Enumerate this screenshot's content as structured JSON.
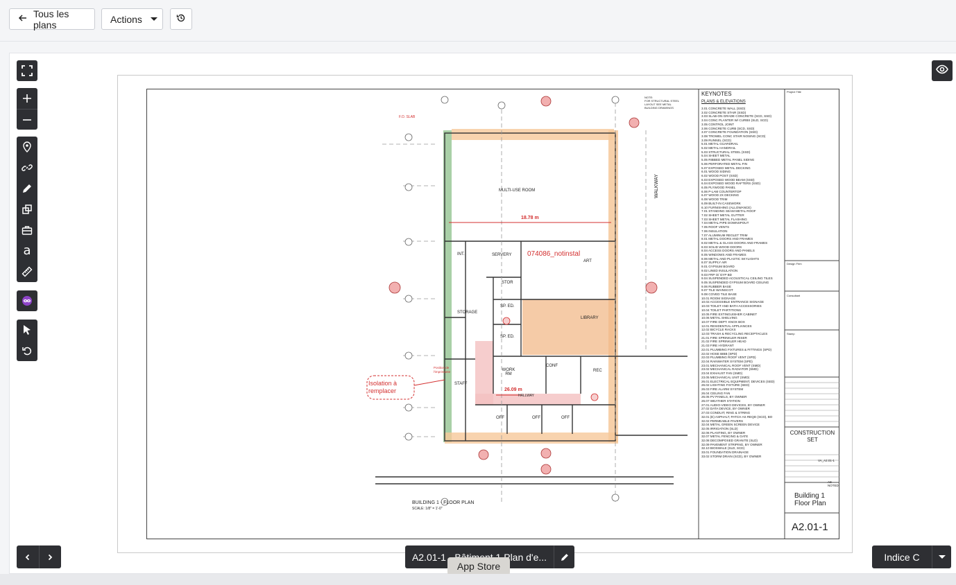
{
  "toolbar": {
    "back_label": "Tous les plans",
    "actions_label": "Actions"
  },
  "plan": {
    "keynotes_title": "KEYNOTES",
    "keynotes_section": "PLANS & ELEVATIONS",
    "keynotes": [
      "3.01 CONCRETE WALL (SSD)",
      "3.02 CONCRETE STAIR (SSD)",
      "3.03 SLAB-ON GRADE CONCRETE (SCD, SSD)",
      "3.04 CONC PLANTER W/ CURBS (SLD, SCD)",
      "3.05 CONTROL JOINT",
      "3.06 CONCRETE CURB (SCD, SSD)",
      "3.07 CONCRETE FOUNDATION (SSD)",
      "3.08 TROWEL CONC STAIR NOSING (SCD)",
      "3.09 RUNNEL (SCD)",
      "5.01 METAL GUARDRAIL",
      "5.02 METAL HANDRAIL",
      "5.03 STRUCTURAL STEEL (SSD)",
      "5.04 SHEET METAL",
      "5.05 RIBBED METAL PANEL SIDING",
      "5.06 PERFORATED METAL FIN",
      "5.07 EXPOSED METAL DECKING",
      "6.01 WOOD SIDING",
      "6.02 WOOD POST (SSD)",
      "6.03 EXPOSED WOOD BEAM (SSD)",
      "6.04 EXPOSED WOOD RAFTERS (SSD)",
      "6.05 PLYWOOD PANEL",
      "6.06 P-LAM COUNTERTOP",
      "6.07 WOOD 2X DECKING",
      "6.08 WOOD TRIM",
      "6.09 BUILT-IN CASEWORK",
      "6.10 FURNISHING (ALLOWANCE)",
      "7.01 STANDING SEAM METAL ROOF",
      "7.02 SHEET METAL GUTTER",
      "7.03 SHEET METAL FLASHING",
      "7.04 METAL PIPE DOWNSPOUT",
      "7.05 ROOF VENTS",
      "7.06 INSULATION",
      "7.07 ALUMINUM REGLET TRIM",
      "8.01 METAL DOORS AND FRAMES",
      "8.02 METAL & GLASS DOORS AND FRAMES",
      "8.03 SOLID WOOD DOORS",
      "8.04 ACCESS DOORS AND PANELS",
      "8.05 WINDOWS AND FRAMES",
      "8.06 METAL AND PLASTIC SKYLIGHTS",
      "8.07 SUPPLY AIR",
      "9.01 GYPSUM BOARD",
      "9.02 LINED INSULATION",
      "9.03 FRP O/ GYP BD",
      "9.04 SUSPENDED ACOUSTICAL CEILING TILES",
      "9.05 SUSPENDED GYPSUM BOARD CEILING",
      "9.06 RUBBER BASE",
      "9.07 TILE WAINSCOT",
      "9.08 COVED TILE BASE",
      "10.01 ROOM SIGNAGE",
      "10.02 ACCESSIBLE ENTRANCE SIGNAGE",
      "10.03 TOILET AND BATH ACCESSORIES",
      "10.04 TOILET PARTITIONS",
      "10.05 FIRE EXTINGUISHER CABINET",
      "10.06 METAL SHELVING",
      "10.07 FIRE DEPT. KNOX BOX",
      "12.01 RESIDENTIAL APPLIANCES",
      "12.02 BICYCLE RACKS",
      "12.03 TRASH & RECYCLING RECEPTACLES",
      "21.01 FIRE SPRINKLER RISER",
      "21.02 FIRE SPRINKLER HEAD",
      "21.03 FIRE HYDRANT",
      "22.01 PLUMBING FIXTURES & FITTINGS (SPD)",
      "22.02 HOSE BIBB (SPD)",
      "22.03 PLUMBING ROOF VENT (SPD)",
      "22.04 RAINWATER SYSTEM (SPD)",
      "23.01 MECHANICAL ROOF VENT (SMD)",
      "23.02 MECHANICAL RADIATOR (SMD)",
      "23.04 EXHAUST FAN (SMD)",
      "23.05 MECHANICAL UNIT (SMD)",
      "26.01 ELECTRICAL EQUIPMENT, DEVICES (SED)",
      "26.02 LIGHTING FIXTURE (SED)",
      "26.03 FIRE ALARM SYSTEM",
      "26.04 CEILING FAN",
      "26.05 PV PANELS, BY OWNER",
      "26.07 WEATHER STATION",
      "27.01 AUDIO-VIDEO DEVICES, BY OWNER",
      "27.02 DATA DEVICE, BY OWNER",
      "27.03 CONDUIT, RING & STRING",
      "32.01 (E) ASPHALT, PATCH AS REQD (SCD), BO",
      "32.02 PERMEABLE PAVERS",
      "32.04 METAL GREEN SCREEN DEVICE",
      "32.05 IRRIGATION (SLD)",
      "32.06 PLANTING, BY OWNER",
      "32.07 METAL FENCING & GATE",
      "32.08 DECOMPOSED GRANITE (SLD)",
      "32.09 PAVEMENT STRIPING, BY OWNER",
      "32.10 BIOSWALE (SLD, SCD)",
      "33.01 FOUNDATION DRAINAGE",
      "33.02 STORM DRAIN (SCD), BY OWNER"
    ],
    "title_block": {
      "project_title": "Project Title",
      "design_firm": "Design Firm",
      "consultant": "Consultant",
      "stamp": "Stamp",
      "issue_stage": "CONSTRUCTION\nSET",
      "sheet_title": "Building 1\nFloor Plan",
      "sheet_number": "A2.01-1",
      "file_name": "VA_A2.01-1",
      "scale": "AS NOTED"
    },
    "rooms": [
      "MULTI-USE ROOM",
      "SERVERY",
      "INT.",
      "STOR",
      "SP. ED.",
      "SP. ED.",
      "STORAGE",
      "LIBRARY",
      "ART",
      "WORK RM",
      "CONF",
      "REC",
      "HALLWAY",
      "STAFF",
      "OFF",
      "OFF",
      "OFF"
    ],
    "walkway_label": "WALKWAY",
    "dimension_1": "18.78 m",
    "dimension_2": "26.09 m",
    "markup_label": "074086_notinstal",
    "cloud_text": "Isolation à\nremplacer",
    "printer_note": "Position de\nl'imprimante",
    "plan_title": "BUILDING 1 - FLOOR PLAN",
    "plan_scale": "SCALE: 1/8\" = 1'-0\"",
    "slab_label": "F.O. SLAB",
    "note_structural": "NOTE:\nFOR STRUCTURAL STEEL\nLAYOUT SEE METAL\nBUILDING DRAWINGS"
  },
  "footer": {
    "sheet_name": "A2.01-1 - Bâtiment 1 Plan d'e...",
    "tooltip": "App Store",
    "revision": "Indice C"
  },
  "colors": {
    "green_highlight": "#6fae6a",
    "orange_highlight": "#f0a45a",
    "pink_highlight": "#f2b8b8",
    "markup_red": "#d32f2f",
    "tool_dark": "#2e2f33",
    "pin_orange": "#f0883a"
  }
}
